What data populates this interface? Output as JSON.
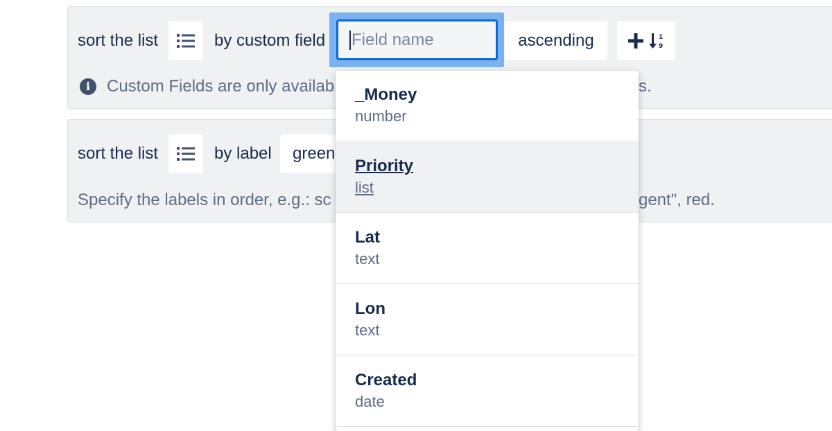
{
  "rule1": {
    "prefix": "sort the list",
    "by_label": "by custom field",
    "field_placeholder": "Field name",
    "direction": "ascending",
    "info_text_left": "Custom Fields are only availab",
    "info_text_right": "s.",
    "list_icon": "list-icon",
    "add_icon": "plus-icon",
    "sort_icon": "sort-numeric-icon"
  },
  "rule2": {
    "prefix": "sort the list",
    "by_label": "by label",
    "label_value": "green",
    "hint_left": "Specify the labels in order, e.g.: sc",
    "hint_right": "gent\", red.",
    "list_icon": "list-icon"
  },
  "dropdown": {
    "items": [
      {
        "name": "_Money",
        "type": "number"
      },
      {
        "name": "Priority",
        "type": "list"
      },
      {
        "name": "Lat",
        "type": "text"
      },
      {
        "name": "Lon",
        "type": "text"
      },
      {
        "name": "Created",
        "type": "date"
      }
    ],
    "hovered_index": 1
  },
  "colors": {
    "card_bg": "#f0f1f3",
    "input_focus_border": "#0c66d6",
    "input_focus_halo": "#7ab2f0",
    "text_primary": "#172b4d",
    "text_secondary": "#5e6c84"
  }
}
